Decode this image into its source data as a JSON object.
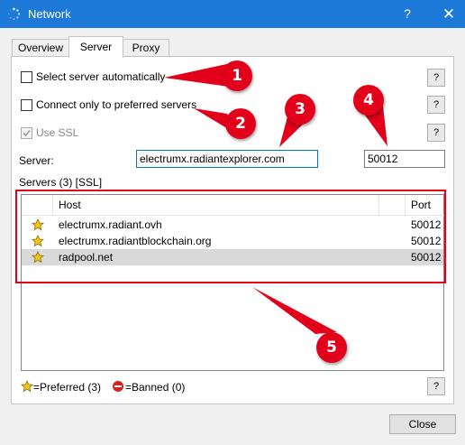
{
  "window": {
    "title": "Network",
    "help_label": "?",
    "close_label": "✕"
  },
  "tabs": [
    {
      "label": "Overview"
    },
    {
      "label": "Server"
    },
    {
      "label": "Proxy"
    }
  ],
  "options": {
    "auto_select_label": "Select server automatically",
    "preferred_only_label": "Connect only to preferred servers",
    "use_ssl_label": "Use SSL",
    "help_label": "?"
  },
  "server": {
    "label": "Server:",
    "host_value": "electrumx.radiantexplorer.com",
    "port_value": "50012"
  },
  "servers_list": {
    "heading": "Servers (3)  [SSL]",
    "columns": {
      "host": "Host",
      "port": "Port"
    },
    "rows": [
      {
        "host": "electrumx.radiant.ovh",
        "port": "50012"
      },
      {
        "host": "electrumx.radiantblockchain.org",
        "port": "50012"
      },
      {
        "host": "radpool.net",
        "port": "50012"
      }
    ]
  },
  "legend": {
    "preferred": "=Preferred (3)",
    "banned": "=Banned (0)"
  },
  "callouts": [
    "1",
    "2",
    "3",
    "4",
    "5"
  ],
  "footer": {
    "close_label": "Close"
  },
  "colors": {
    "titlebar": "#1c79d8",
    "callout": "#e3001b",
    "star": "#f5c518"
  }
}
